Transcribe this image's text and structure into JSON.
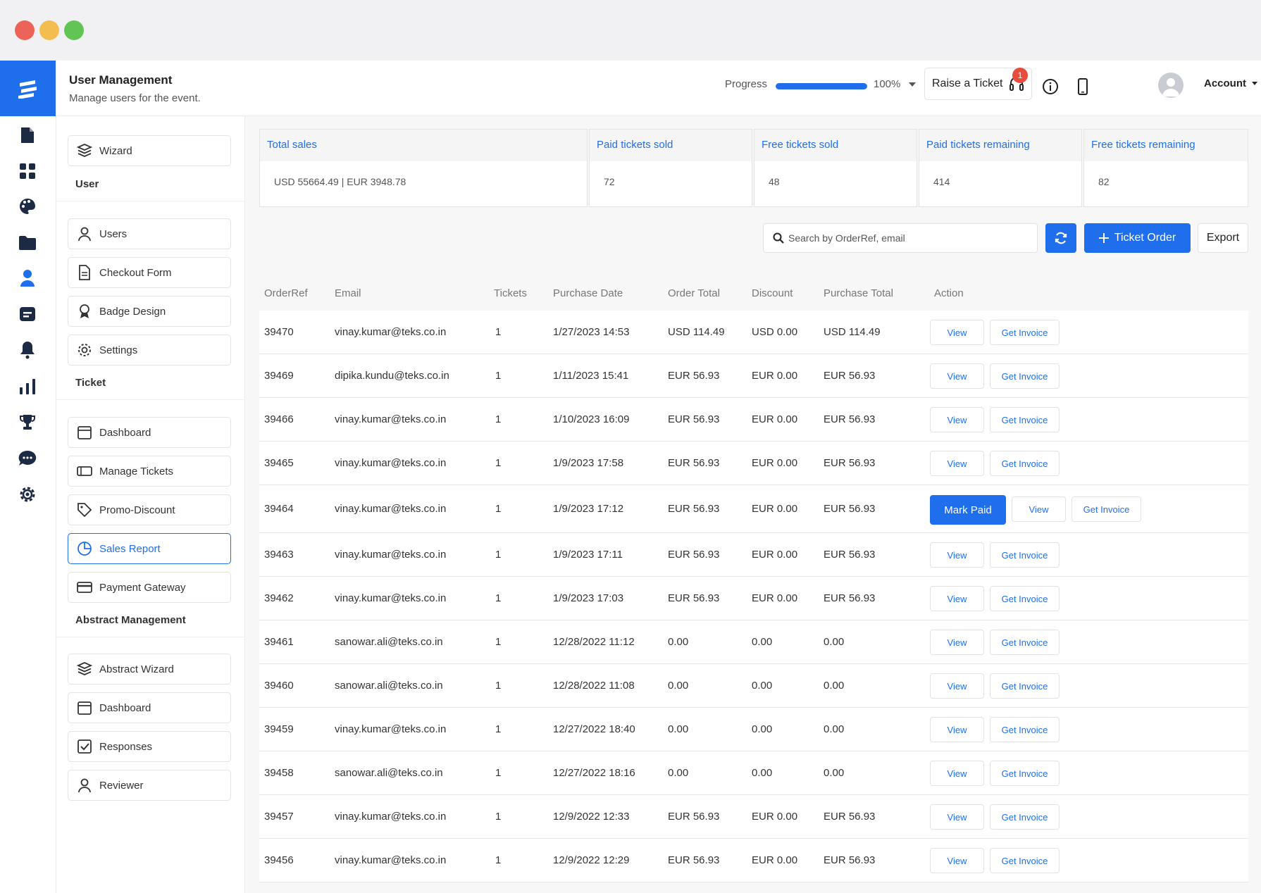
{
  "colors": {
    "accent": "#1f6fec",
    "titlebar": "#f1f1f3",
    "red": "#ec6459",
    "yellow": "#f4bd4f",
    "green": "#61c454",
    "badge": "#e74c3c"
  },
  "header": {
    "title": "User Management",
    "subtitle": "Manage users for the event.",
    "progress_label": "Progress",
    "progress_value": "100%",
    "progress_fraction": 1.0,
    "raise_ticket": "Raise a Ticket",
    "notification_count": "1",
    "account": "Account"
  },
  "rail_icons": [
    "document-icon",
    "grid-icon",
    "palette-icon",
    "folder-icon",
    "user-icon",
    "ticket-icon",
    "bell-icon",
    "bar-chart-icon",
    "trophy-icon",
    "chat-icon",
    "gear-icon"
  ],
  "sidebar": {
    "wizard": "Wizard",
    "user_section": "User",
    "users": "Users",
    "checkout_form": "Checkout Form",
    "badge_design": "Badge Design",
    "settings": "Settings",
    "ticket_section": "Ticket",
    "dashboard": "Dashboard",
    "manage_tickets": "Manage Tickets",
    "promo_discount": "Promo-Discount",
    "sales_report": "Sales Report",
    "payment_gateway": "Payment Gateway",
    "abstract_section": "Abstract Management",
    "abstract_wizard": "Abstract Wizard",
    "abstract_dashboard": "Dashboard",
    "responses": "Responses",
    "reviewer": "Reviewer"
  },
  "stats": [
    {
      "label": "Total sales",
      "value": "USD 55664.49 |  EUR 3948.78"
    },
    {
      "label": "Paid tickets sold",
      "value": "72"
    },
    {
      "label": "Free tickets sold",
      "value": "48"
    },
    {
      "label": "Paid tickets remaining",
      "value": "414"
    },
    {
      "label": "Free tickets remaining",
      "value": "82"
    }
  ],
  "toolbar": {
    "search_placeholder": "Search by OrderRef, email",
    "ticket_order": "Ticket Order",
    "export": "Export"
  },
  "table": {
    "headers": [
      "OrderRef",
      "Email",
      "Tickets",
      "Purchase Date",
      "Order Total",
      "Discount",
      "Purchase Total",
      "Action"
    ],
    "view_label": "View",
    "invoice_label": "Get Invoice",
    "mark_paid_label": "Mark Paid",
    "rows": [
      {
        "ref": "39470",
        "email": "vinay.kumar@teks.co.in",
        "tickets": "1",
        "date": "1/27/2023 14:53",
        "order_total": "USD 114.49",
        "discount": "USD 0.00",
        "purchase_total": "USD 114.49",
        "mark_paid": false
      },
      {
        "ref": "39469",
        "email": "dipika.kundu@teks.co.in",
        "tickets": "1",
        "date": "1/11/2023 15:41",
        "order_total": "EUR 56.93",
        "discount": "EUR 0.00",
        "purchase_total": "EUR 56.93",
        "mark_paid": false
      },
      {
        "ref": "39466",
        "email": "vinay.kumar@teks.co.in",
        "tickets": "1",
        "date": "1/10/2023 16:09",
        "order_total": "EUR 56.93",
        "discount": "EUR 0.00",
        "purchase_total": "EUR 56.93",
        "mark_paid": false
      },
      {
        "ref": "39465",
        "email": "vinay.kumar@teks.co.in",
        "tickets": "1",
        "date": "1/9/2023 17:58",
        "order_total": "EUR 56.93",
        "discount": "EUR 0.00",
        "purchase_total": "EUR 56.93",
        "mark_paid": false
      },
      {
        "ref": "39464",
        "email": "vinay.kumar@teks.co.in",
        "tickets": "1",
        "date": "1/9/2023 17:12",
        "order_total": "EUR 56.93",
        "discount": "EUR 0.00",
        "purchase_total": "EUR 56.93",
        "mark_paid": true
      },
      {
        "ref": "39463",
        "email": "vinay.kumar@teks.co.in",
        "tickets": "1",
        "date": "1/9/2023 17:11",
        "order_total": "EUR 56.93",
        "discount": "EUR 0.00",
        "purchase_total": "EUR 56.93",
        "mark_paid": false
      },
      {
        "ref": "39462",
        "email": "vinay.kumar@teks.co.in",
        "tickets": "1",
        "date": "1/9/2023 17:03",
        "order_total": "EUR 56.93",
        "discount": "EUR 0.00",
        "purchase_total": "EUR 56.93",
        "mark_paid": false
      },
      {
        "ref": "39461",
        "email": "sanowar.ali@teks.co.in",
        "tickets": "1",
        "date": "12/28/2022 11:12",
        "order_total": "0.00",
        "discount": "0.00",
        "purchase_total": "0.00",
        "mark_paid": false
      },
      {
        "ref": "39460",
        "email": "sanowar.ali@teks.co.in",
        "tickets": "1",
        "date": "12/28/2022 11:08",
        "order_total": "0.00",
        "discount": "0.00",
        "purchase_total": "0.00",
        "mark_paid": false
      },
      {
        "ref": "39459",
        "email": "vinay.kumar@teks.co.in",
        "tickets": "1",
        "date": "12/27/2022 18:40",
        "order_total": "0.00",
        "discount": "0.00",
        "purchase_total": "0.00",
        "mark_paid": false
      },
      {
        "ref": "39458",
        "email": "sanowar.ali@teks.co.in",
        "tickets": "1",
        "date": "12/27/2022 18:16",
        "order_total": "0.00",
        "discount": "0.00",
        "purchase_total": "0.00",
        "mark_paid": false
      },
      {
        "ref": "39457",
        "email": "vinay.kumar@teks.co.in",
        "tickets": "1",
        "date": "12/9/2022 12:33",
        "order_total": "EUR 56.93",
        "discount": "EUR 0.00",
        "purchase_total": "EUR 56.93",
        "mark_paid": false
      },
      {
        "ref": "39456",
        "email": "vinay.kumar@teks.co.in",
        "tickets": "1",
        "date": "12/9/2022 12:29",
        "order_total": "EUR 56.93",
        "discount": "EUR 0.00",
        "purchase_total": "EUR 56.93",
        "mark_paid": false
      }
    ]
  }
}
